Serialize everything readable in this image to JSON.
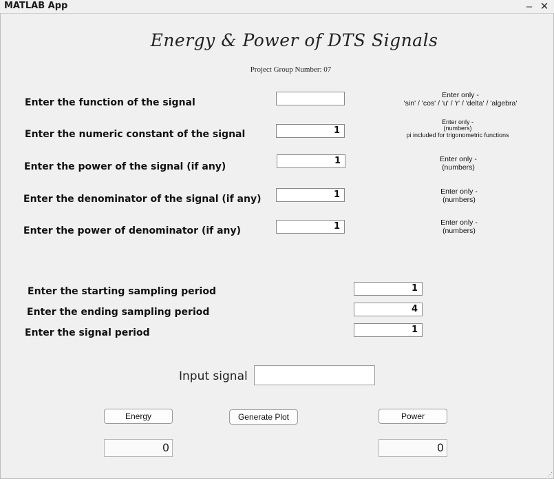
{
  "window": {
    "title": "MATLAB App",
    "minimize_glyph": "–",
    "close_glyph": "✕"
  },
  "header": {
    "title": "Energy & Power of DTS Signals",
    "subtitle": "Project Group Number: 07"
  },
  "signal_form": {
    "function": {
      "label": "Enter the function of the signal",
      "value": "",
      "hint_line1": "Enter only -",
      "hint_line2": "'sin' / 'cos' / 'u' / 'r' / 'delta' / 'algebra'"
    },
    "constant": {
      "label": "Enter the numeric constant of the signal",
      "value": "1",
      "hint_line1": "Enter only -",
      "hint_line2": "(numbers)",
      "hint_line3": "pi included for trigonometric functions"
    },
    "power": {
      "label": "Enter the power of the signal (if any)",
      "value": "1",
      "hint_line1": "Enter only -",
      "hint_line2": "(numbers)"
    },
    "denominator": {
      "label": "Enter the denominator of the signal (if any)",
      "value": "1",
      "hint_line1": "Enter only -",
      "hint_line2": "(numbers)"
    },
    "denominator_power": {
      "label": "Enter the power of denominator (if any)",
      "value": "1",
      "hint_line1": "Enter only -",
      "hint_line2": "(numbers)"
    }
  },
  "sampling_form": {
    "start": {
      "label": "Enter the starting sampling period",
      "value": "1"
    },
    "end": {
      "label": "Enter the ending sampling period",
      "value": "4"
    },
    "period": {
      "label": "Enter the signal period",
      "value": "1"
    }
  },
  "input_signal": {
    "label": "Input signal",
    "value": ""
  },
  "actions": {
    "energy_label": "Energy",
    "generate_label": "Generate Plot",
    "power_label": "Power"
  },
  "results": {
    "energy_value": "0",
    "power_value": "0"
  }
}
